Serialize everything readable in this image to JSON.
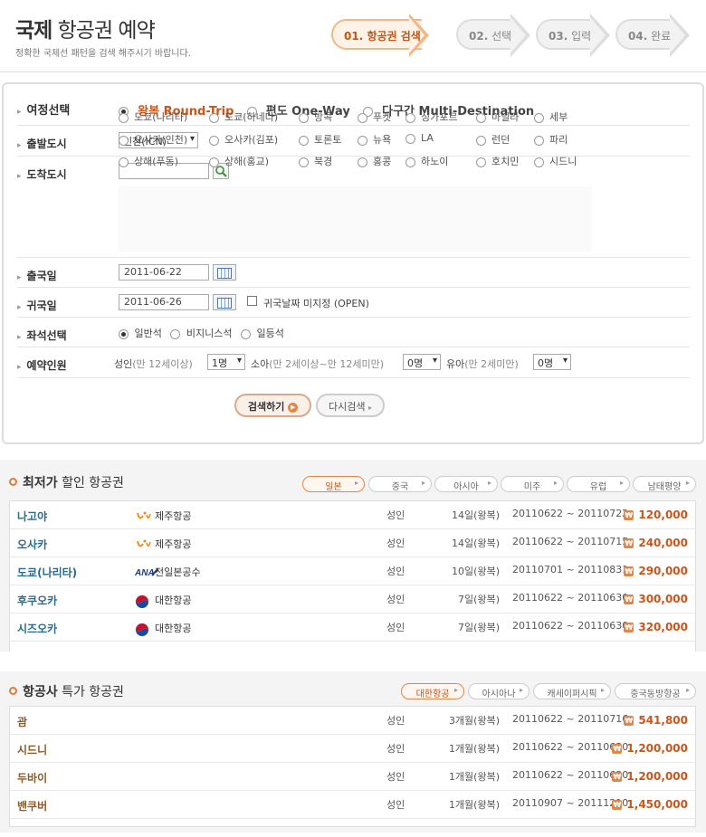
{
  "header": {
    "title_bold": "국제",
    "title_rest": " 항공권 예약",
    "subtitle": "정확한 국제선 패턴을 검색 해주시기 바랍니다."
  },
  "steps": [
    {
      "num": "01.",
      "label": "항공권 검색",
      "active": true
    },
    {
      "num": "02.",
      "label": "선택",
      "active": false
    },
    {
      "num": "03.",
      "label": "입력",
      "active": false
    },
    {
      "num": "04.",
      "label": "완료",
      "active": false
    }
  ],
  "form": {
    "trip_label": "여정선택",
    "trip_options": [
      "왕복 Round-Trip",
      "편도 One-Way",
      "다구간 Multi-Destination"
    ],
    "trip_selected": 0,
    "depart_label": "출발도시",
    "depart_value": "인천(ICN)",
    "arrive_label": "도착도시",
    "arrive_value": "",
    "cities": [
      [
        "도쿄(나리타)",
        "도쿄(하네다)",
        "방콕",
        "푸켓",
        "싱가포르",
        "마닐라",
        "세부"
      ],
      [
        "오사카(인천)",
        "오사카(김포)",
        "토론토",
        "뉴욕",
        "LA",
        "런던",
        "파리"
      ],
      [
        "상해(푸동)",
        "상해(홍교)",
        "북경",
        "홍콩",
        "하노이",
        "호치민",
        "시드니"
      ]
    ],
    "out_label": "출국일",
    "out_date": "2011-06-22",
    "ret_label": "귀국일",
    "ret_date": "2011-06-26",
    "open_label": "귀국날짜 미지정 (OPEN)",
    "seat_label": "좌석선택",
    "seat_options": [
      "일반석",
      "비지니스석",
      "일등석"
    ],
    "seat_selected": 0,
    "pax_label": "예약인원",
    "adult_label": "성인",
    "adult_note": "(만 12세이상)",
    "adult_value": "1명",
    "child_label": "소아",
    "child_note": "(만 2세이상~만 12세미만)",
    "child_value": "0명",
    "infant_label": "유아",
    "infant_note": "(만 2세미만)",
    "infant_value": "0명",
    "search_btn": "검색하기",
    "reset_btn": "다시검색"
  },
  "lowest": {
    "title_bold": "최저가",
    "title_rest": " 할인 항공권",
    "tabs": [
      "일본",
      "중국",
      "아시아",
      "미주",
      "유럽",
      "남태평양"
    ],
    "rows": [
      {
        "city": "나고야",
        "airline": "제주항공",
        "logo": "jeju",
        "pax": "성인",
        "dur": "14일(왕복)",
        "dates": "20110622 ~ 20110722",
        "price": "120,000"
      },
      {
        "city": "오사카",
        "airline": "제주항공",
        "logo": "jeju",
        "pax": "성인",
        "dur": "14일(왕복)",
        "dates": "20110622 ~ 20110715",
        "price": "240,000"
      },
      {
        "city": "도쿄(나리타)",
        "airline": "전일본공수",
        "logo": "ana",
        "pax": "성인",
        "dur": "10일(왕복)",
        "dates": "20110701 ~ 20110831",
        "price": "290,000"
      },
      {
        "city": "후쿠오카",
        "airline": "대한항공",
        "logo": "korean",
        "pax": "성인",
        "dur": "7일(왕복)",
        "dates": "20110622 ~ 20110630",
        "price": "300,000"
      },
      {
        "city": "시즈오카",
        "airline": "대한항공",
        "logo": "korean",
        "pax": "성인",
        "dur": "7일(왕복)",
        "dates": "20110622 ~ 20110630",
        "price": "320,000"
      }
    ]
  },
  "special": {
    "title_bold": "항공사",
    "title_rest": " 특가 항공권",
    "tabs": [
      "대한항공",
      "아시아나",
      "캐세이퍼시픽",
      "중국동방항공"
    ],
    "rows": [
      {
        "city": "괌",
        "pax": "성인",
        "dur": "3개월(왕복)",
        "dates": "20110622 ~ 20110716",
        "price": "541,800"
      },
      {
        "city": "시드니",
        "pax": "성인",
        "dur": "1개월(왕복)",
        "dates": "20110622 ~ 20110630",
        "price": "1,200,000"
      },
      {
        "city": "두바이",
        "pax": "성인",
        "dur": "1개월(왕복)",
        "dates": "20110622 ~ 20110630",
        "price": "1,200,000"
      },
      {
        "city": "밴쿠버",
        "pax": "성인",
        "dur": "1개월(왕복)",
        "dates": "20110907 ~ 20111210",
        "price": "1,450,000"
      }
    ]
  },
  "colors": {
    "accent": "#c9551a",
    "city_blue": "#2a6a8a"
  }
}
